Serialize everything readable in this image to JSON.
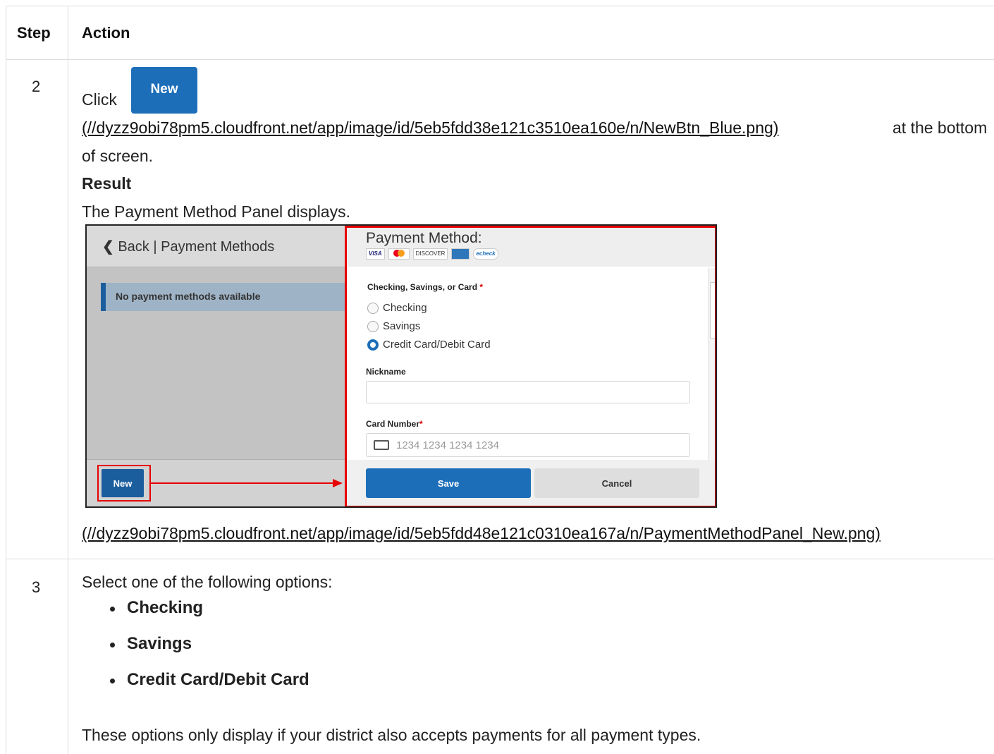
{
  "table": {
    "headers": {
      "step": "Step",
      "action": "Action"
    },
    "row2": {
      "step": "2",
      "click_prefix": "Click",
      "new_button_label": "New",
      "new_button_link": "(//dyzz9obi78pm5.cloudfront.net/app/image/id/5eb5fdd38e121c3510ea160e/n/NewBtn_Blue.png)",
      "suffix_1": "at the bottom",
      "suffix_2": "of screen.",
      "result_heading": "Result",
      "result_text": "The Payment Method Panel displays.",
      "panel_link": "(//dyzz9obi78pm5.cloudfront.net/app/image/id/5eb5fdd48e121c0310ea167a/n/PaymentMethodPanel_New.png)"
    },
    "row3": {
      "step": "3",
      "intro": "Select one of the following options:",
      "options": [
        "Checking",
        "Savings",
        "Credit Card/Debit Card"
      ],
      "note": "These options only display if your district also accepts payments for all payment types."
    }
  },
  "screenshot": {
    "back_label": "Back | Payment Methods",
    "empty_message": "No payment methods available",
    "new_label": "New",
    "panel_title": "Payment Method:",
    "card_logos": [
      "VISA",
      "MC",
      "DISCOVER",
      "AMEX",
      "echeck"
    ],
    "type_label": "Checking, Savings, or Card",
    "required_mark": "*",
    "radio_options": [
      "Checking",
      "Savings",
      "Credit Card/Debit Card"
    ],
    "selected_option": "Credit Card/Debit Card",
    "nickname_label": "Nickname",
    "card_number_label": "Card Number",
    "card_number_placeholder": "1234 1234 1234 1234",
    "save_label": "Save",
    "cancel_label": "Cancel",
    "highlight_color": "#e60000",
    "accent_color": "#1c6eb9"
  }
}
